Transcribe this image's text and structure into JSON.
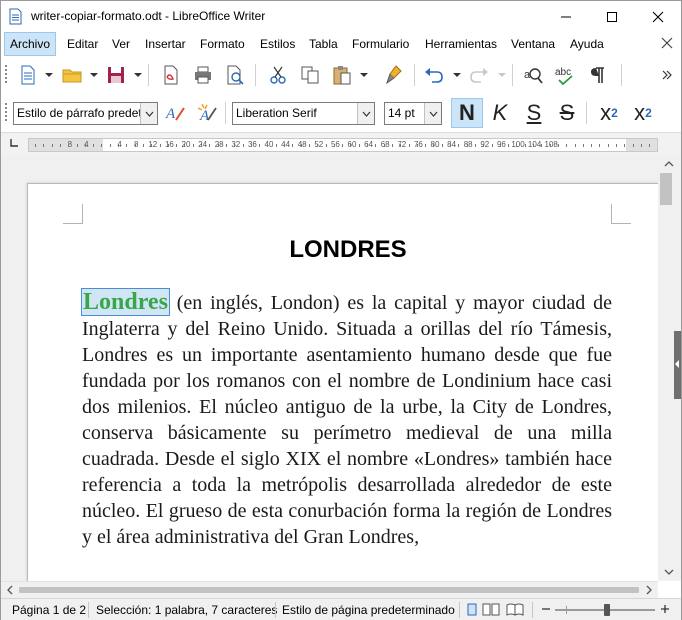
{
  "window": {
    "title": "writer-copiar-formato.odt - LibreOffice Writer"
  },
  "menubar": {
    "items": [
      "Archivo",
      "Editar",
      "Ver",
      "Insertar",
      "Formato",
      "Estilos",
      "Tabla",
      "Formulario",
      "Herramientas",
      "Ventana",
      "Ayuda"
    ]
  },
  "toolbar": {
    "icons": [
      "new-document-icon",
      "open-folder-icon",
      "save-icon",
      "export-pdf-icon",
      "print-icon",
      "print-preview-icon",
      "cut-icon",
      "copy-icon",
      "paste-icon",
      "clone-formatting-icon",
      "undo-icon",
      "redo-icon",
      "find-replace-icon",
      "spelling-icon",
      "formatting-marks-icon"
    ]
  },
  "formatting": {
    "paragraph_style": "Estilo de párrafo predet",
    "font_name": "Liberation Serif",
    "font_size": "14 pt",
    "bold_label": "N",
    "italic_label": "K",
    "underline_label": "S",
    "strike_label": "S",
    "superscript_label": "x",
    "superscript_exp": "2",
    "subscript_label": "x",
    "subscript_idx": "2"
  },
  "ruler": {
    "numbers": [
      "8",
      "4",
      "4",
      "8",
      "12",
      "16",
      "20",
      "24",
      "28",
      "32",
      "36",
      "40",
      "44",
      "48",
      "52",
      "56",
      "60",
      "64",
      "68",
      "72",
      "76",
      "80",
      "84",
      "88",
      "92",
      "96",
      "100",
      "104",
      "108"
    ]
  },
  "document": {
    "heading": "LONDRES",
    "selected_word": "Londres",
    "body_rest": " (en inglés, London) es la capital y mayor ciudad de Inglaterra y del Reino Unido. Situada a orillas del río Támesis, Londres es un importante asentamiento humano desde que fue fundada por los romanos con el nombre de Londinium hace casi dos milenios. El núcleo antiguo de la urbe, la City de Londres, conserva básicamente su perímetro medieval de una milla cuadrada. Desde el siglo XIX el nombre «Londres» también hace referencia a toda la metrópolis desarrollada alrededor de este núcleo. El grueso de esta conurbación forma la región de Londres y el área administrativa del Gran Londres,",
    "selected_color": "#3aa64a"
  },
  "statusbar": {
    "page": "Página 1 de 2",
    "selection": "Selección: 1 palabra, 7 caracteres",
    "page_style": "Estilo de página predeterminado"
  },
  "colors": {
    "accent": "#cce4f7",
    "accent_border": "#99c9ef"
  }
}
